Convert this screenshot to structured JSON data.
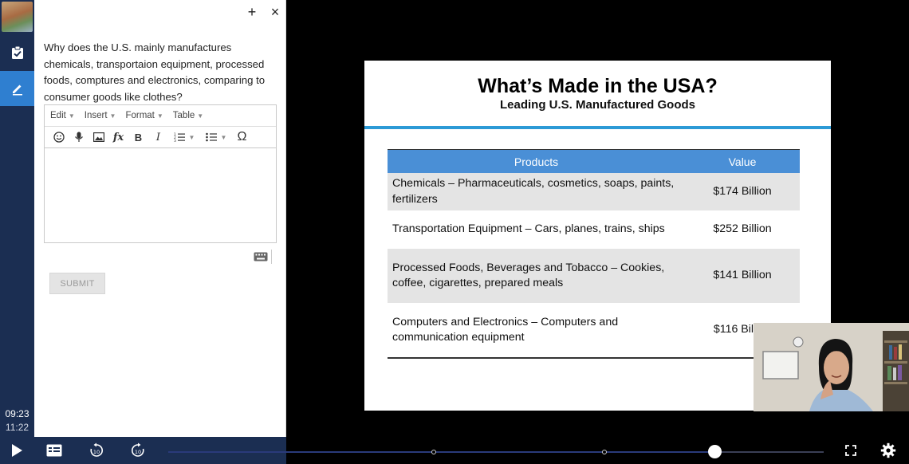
{
  "rail": {
    "time_elapsed": "09:23",
    "time_total": "11:22",
    "icons": [
      "thumbnail-image",
      "assignment-check-icon",
      "pencil-icon"
    ]
  },
  "panel": {
    "add_icon": "+",
    "close_icon": "×",
    "question": "Why does the U.S. mainly manufactures chemicals, transportaion equipment, processed foods, comptures and electronics, comparing to consumer goods like clothes?",
    "menus": [
      "Edit",
      "Insert",
      "Format",
      "Table"
    ],
    "submit_label": "SUBMIT"
  },
  "slide": {
    "title": "What’s Made in the USA?",
    "subtitle": "Leading U.S. Manufactured Goods",
    "headers": [
      "Products",
      "Value"
    ],
    "rows": [
      {
        "product": "Chemicals – Pharmaceuticals, cosmetics, soaps, paints, fertilizers",
        "value": "$174 Billion"
      },
      {
        "product": "Transportation Equipment – Cars, planes, trains, ships",
        "value": "$252 Billion"
      },
      {
        "product": "Processed Foods, Beverages and Tobacco – Cookies, coffee, cigarettes, prepared meals",
        "value": "$141 Billion"
      },
      {
        "product": "Computers and Electronics – Computers and communication equipment",
        "value": "$116 Billion"
      }
    ]
  },
  "player": {
    "progress": 0.833,
    "colors": {
      "accent": "#2f7fd0",
      "rail": "#1b2e52",
      "table_header": "#4a8fd6"
    }
  }
}
